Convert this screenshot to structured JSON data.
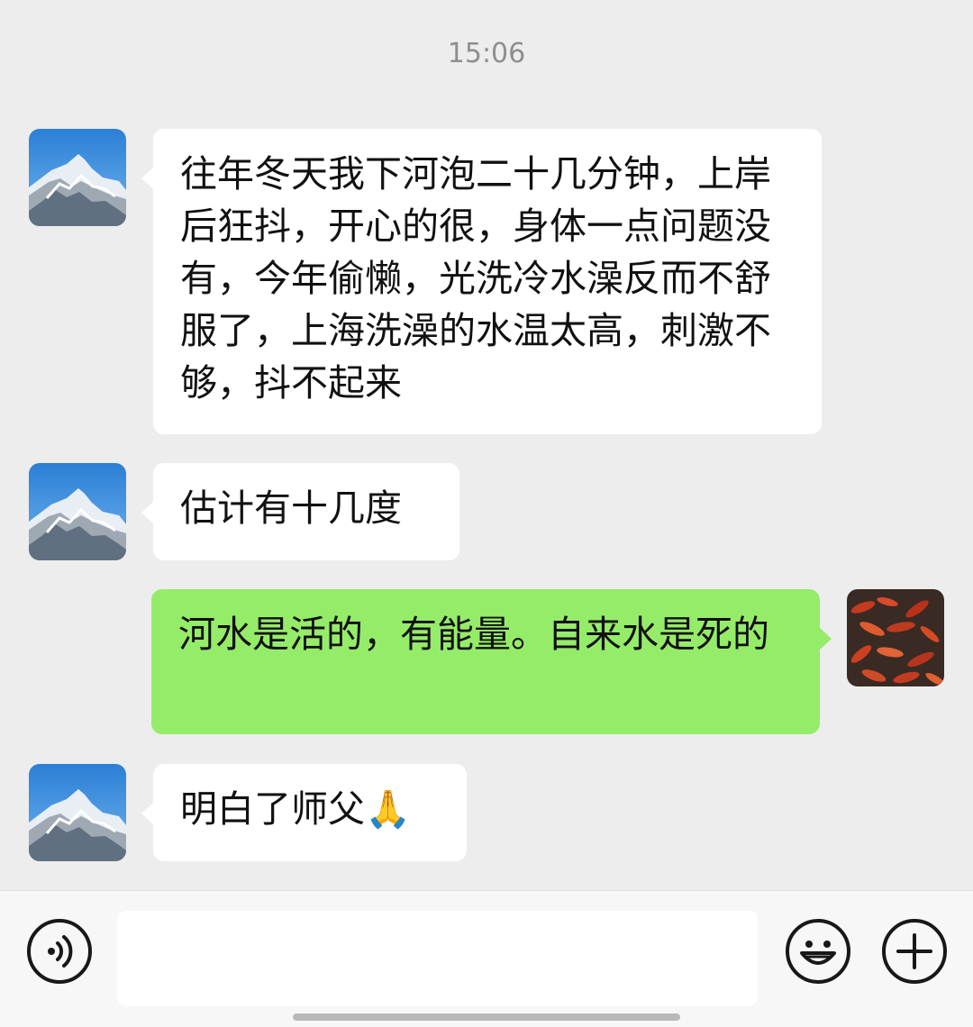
{
  "chat": {
    "timestamp": "15:06",
    "messages": [
      {
        "direction": "incoming",
        "avatar": "mountain-avatar",
        "text": "往年冬天我下河泡二十几分钟，上岸后狂抖，开心的很，身体一点问题没有，今年偷懒，光洗冷水澡反而不舒服了，上海洗澡的水温太高，刺激不够，抖不起来"
      },
      {
        "direction": "incoming",
        "avatar": "mountain-avatar",
        "text": "估计有十几度"
      },
      {
        "direction": "outgoing",
        "avatar": "red-fish-avatar",
        "text": "河水是活的，有能量。自来水是死的"
      },
      {
        "direction": "incoming",
        "avatar": "mountain-avatar",
        "text": "明白了师父🙏"
      }
    ]
  },
  "input_bar": {
    "voice_icon": "voice-icon",
    "message_value": "",
    "emoji_icon": "emoji-icon",
    "plus_icon": "plus-icon"
  },
  "colors": {
    "background": "#ededed",
    "incoming_bubble": "#ffffff",
    "outgoing_bubble": "#95ec69",
    "timestamp": "#8e8e8e"
  }
}
